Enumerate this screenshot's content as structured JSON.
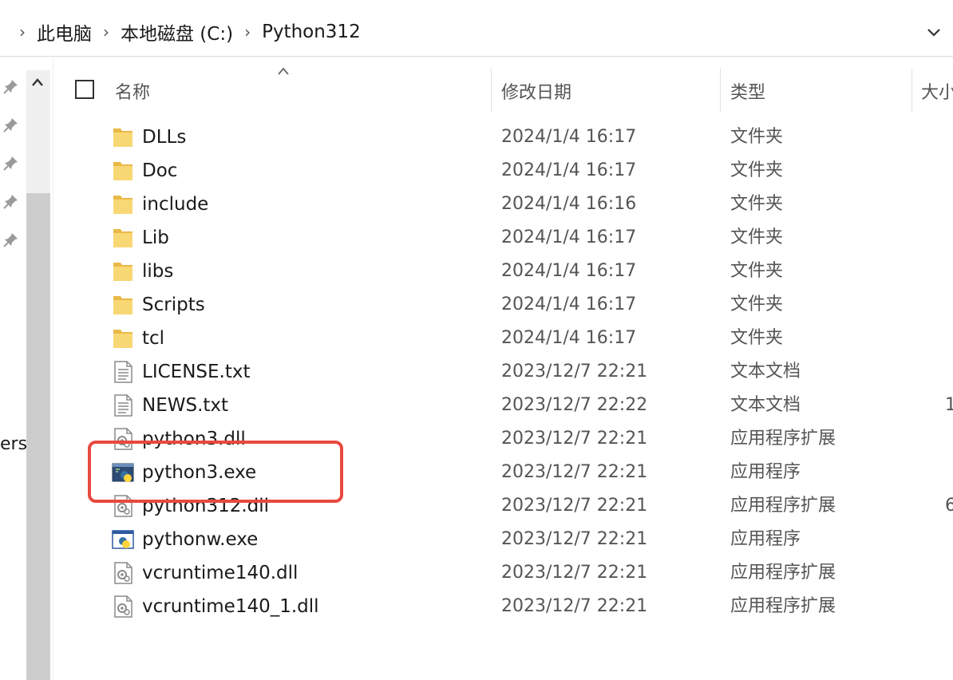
{
  "breadcrumb": {
    "items": [
      "此电脑",
      "本地磁盘 (C:)",
      "Python312"
    ]
  },
  "nav": {
    "cut_text": "erso"
  },
  "columns": {
    "name": "名称",
    "date": "修改日期",
    "type": "类型",
    "size": "大小"
  },
  "files": [
    {
      "name": "DLLs",
      "date": "2024/1/4 16:17",
      "type": "文件夹",
      "size": "",
      "icon": "folder-icon"
    },
    {
      "name": "Doc",
      "date": "2024/1/4 16:17",
      "type": "文件夹",
      "size": "",
      "icon": "folder-icon"
    },
    {
      "name": "include",
      "date": "2024/1/4 16:16",
      "type": "文件夹",
      "size": "",
      "icon": "folder-icon"
    },
    {
      "name": "Lib",
      "date": "2024/1/4 16:17",
      "type": "文件夹",
      "size": "",
      "icon": "folder-icon"
    },
    {
      "name": "libs",
      "date": "2024/1/4 16:17",
      "type": "文件夹",
      "size": "",
      "icon": "folder-icon"
    },
    {
      "name": "Scripts",
      "date": "2024/1/4 16:17",
      "type": "文件夹",
      "size": "",
      "icon": "folder-icon"
    },
    {
      "name": "tcl",
      "date": "2024/1/4 16:17",
      "type": "文件夹",
      "size": "",
      "icon": "folder-icon"
    },
    {
      "name": "LICENSE.txt",
      "date": "2023/12/7 22:21",
      "type": "文本文档",
      "size": "",
      "icon": "text-file-icon"
    },
    {
      "name": "NEWS.txt",
      "date": "2023/12/7 22:22",
      "type": "文本文档",
      "size": "1",
      "icon": "text-file-icon"
    },
    {
      "name": "python3.dll",
      "date": "2023/12/7 22:21",
      "type": "应用程序扩展",
      "size": "",
      "icon": "dll-file-icon"
    },
    {
      "name": "python3.exe",
      "date": "2023/12/7 22:21",
      "type": "应用程序",
      "size": "",
      "icon": "python-exe-icon"
    },
    {
      "name": "python312.dll",
      "date": "2023/12/7 22:21",
      "type": "应用程序扩展",
      "size": "6",
      "icon": "dll-file-icon"
    },
    {
      "name": "pythonw.exe",
      "date": "2023/12/7 22:21",
      "type": "应用程序",
      "size": "",
      "icon": "pythonw-exe-icon"
    },
    {
      "name": "vcruntime140.dll",
      "date": "2023/12/7 22:21",
      "type": "应用程序扩展",
      "size": "",
      "icon": "dll-file-icon"
    },
    {
      "name": "vcruntime140_1.dll",
      "date": "2023/12/7 22:21",
      "type": "应用程序扩展",
      "size": "",
      "icon": "dll-file-icon"
    }
  ],
  "colors": {
    "highlight": "#e8493f",
    "folder": "#f8d775",
    "folder_dark": "#e9b949",
    "python_blue": "#3572a5",
    "python_yellow": "#ffd43b"
  }
}
